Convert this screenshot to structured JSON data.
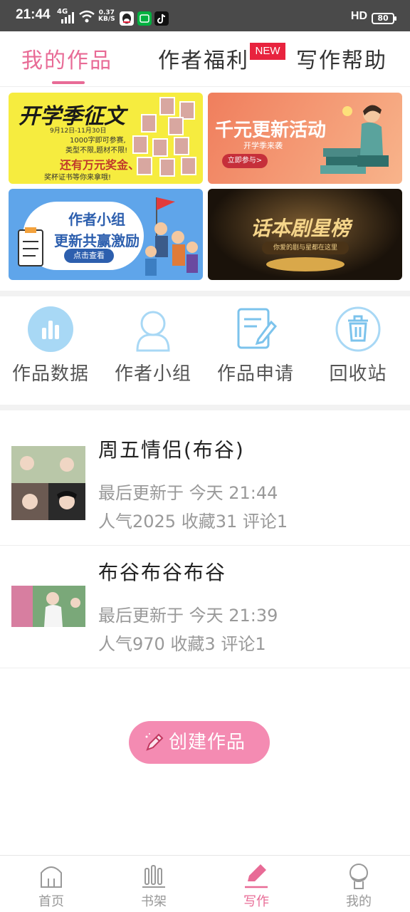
{
  "status_bar": {
    "time": "21:44",
    "network": "4G",
    "speed_value": "0.37",
    "speed_unit": "KB/S",
    "hd": "HD",
    "battery": "80"
  },
  "top_tabs": [
    {
      "label": "我的作品",
      "active": true
    },
    {
      "label": "作者福利",
      "active": false
    },
    {
      "label": "写作帮助",
      "active": false
    }
  ],
  "new_badge": "NEW",
  "banners": {
    "kaixue": {
      "title": "开学季征文",
      "date": "9月12日-11月30日",
      "line1": "1000字即可参赛,",
      "line2": "类型不限,题材不限!",
      "line3": "还有万元奖金、",
      "line4": "奖杯证书等你来拿哦!"
    },
    "qianyuan": {
      "title": "千元更新活动",
      "subtitle": "开学季来袭",
      "button": "立即参与>"
    },
    "group": {
      "title1": "作者小组",
      "title2": "更新共赢激励",
      "button": "点击查看"
    },
    "star": {
      "title": "话本剧星榜",
      "subtitle": "你爱的剧与星都在这里"
    }
  },
  "quick_actions": [
    {
      "label": "作品数据",
      "icon": "bar-chart-icon"
    },
    {
      "label": "作者小组",
      "icon": "group-icon"
    },
    {
      "label": "作品申请",
      "icon": "edit-document-icon"
    },
    {
      "label": "回收站",
      "icon": "trash-icon"
    }
  ],
  "works": [
    {
      "title": "周五情侣(布谷)",
      "updated": "最后更新于 今天 21:44",
      "stats": "人气2025 收藏31 评论1"
    },
    {
      "title": "布谷布谷布谷",
      "updated": "最后更新于 今天 21:39",
      "stats": "人气970 收藏3 评论1"
    }
  ],
  "create_button": "创建作品",
  "bottom_nav": [
    {
      "label": "首页",
      "icon": "home-icon",
      "active": false
    },
    {
      "label": "书架",
      "icon": "bookshelf-icon",
      "active": false
    },
    {
      "label": "写作",
      "icon": "pen-icon",
      "active": true
    },
    {
      "label": "我的",
      "icon": "profile-icon",
      "active": false
    }
  ],
  "colors": {
    "accent": "#e86b96",
    "create_button": "#f48bb2",
    "icon_blue": "#7cc3ec",
    "new_badge": "#e8233e"
  }
}
